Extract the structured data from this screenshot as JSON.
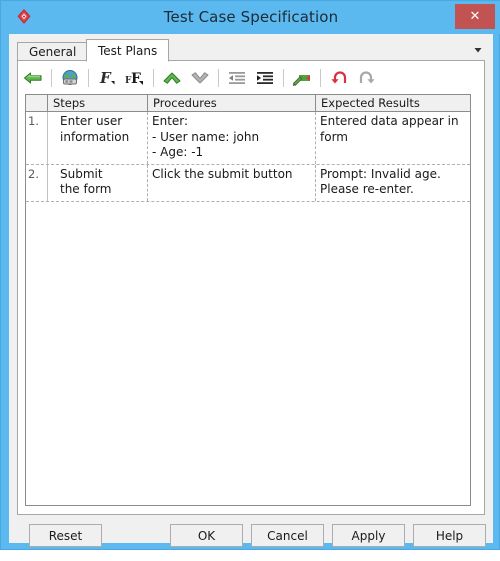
{
  "window": {
    "title": "Test Case Specification",
    "app_icon": "red-diamond-icon",
    "close_label": "✕",
    "frame_color": "#5cb9ef",
    "close_color": "#c25353"
  },
  "tabs": {
    "items": [
      {
        "label": "General",
        "active": false
      },
      {
        "label": "Test Plans",
        "active": true
      }
    ],
    "overflow_icon": "chevron-down-icon"
  },
  "toolbar": {
    "buttons": [
      {
        "name": "back-arrow-icon",
        "tooltip": "Back",
        "enabled": true
      },
      {
        "name": "globe-icon",
        "tooltip": "Web",
        "enabled": true
      },
      {
        "name": "font-icon",
        "tooltip": "Font",
        "enabled": true
      },
      {
        "name": "font-size-icon",
        "tooltip": "Font Size",
        "enabled": true
      },
      {
        "name": "move-up-icon",
        "tooltip": "Move Up",
        "enabled": true
      },
      {
        "name": "move-down-icon",
        "tooltip": "Move Down",
        "enabled": false
      },
      {
        "name": "outdent-icon",
        "tooltip": "Decrease Indent",
        "enabled": false
      },
      {
        "name": "indent-icon",
        "tooltip": "Increase Indent",
        "enabled": true
      },
      {
        "name": "flag-pen-icon",
        "tooltip": "Mark",
        "enabled": true
      },
      {
        "name": "undo-icon",
        "tooltip": "Undo",
        "enabled": true
      },
      {
        "name": "redo-icon",
        "tooltip": "Redo",
        "enabled": false
      }
    ]
  },
  "grid": {
    "columns": [
      {
        "key": "num",
        "label": ""
      },
      {
        "key": "steps",
        "label": "Steps"
      },
      {
        "key": "procedures",
        "label": "Procedures"
      },
      {
        "key": "expected",
        "label": "Expected Results"
      }
    ],
    "rows": [
      {
        "num": "1.",
        "steps": "Enter user\ninformation",
        "procedures": "Enter:\n- User name: john\n- Age: -1",
        "expected": "Entered data appear in\nform"
      },
      {
        "num": "2.",
        "steps": "Submit\nthe form",
        "procedures": "Click the submit button",
        "expected": "Prompt: Invalid age.\nPlease re-enter."
      }
    ]
  },
  "buttons": {
    "reset": "Reset",
    "ok": "OK",
    "cancel": "Cancel",
    "apply": "Apply",
    "help": "Help"
  }
}
